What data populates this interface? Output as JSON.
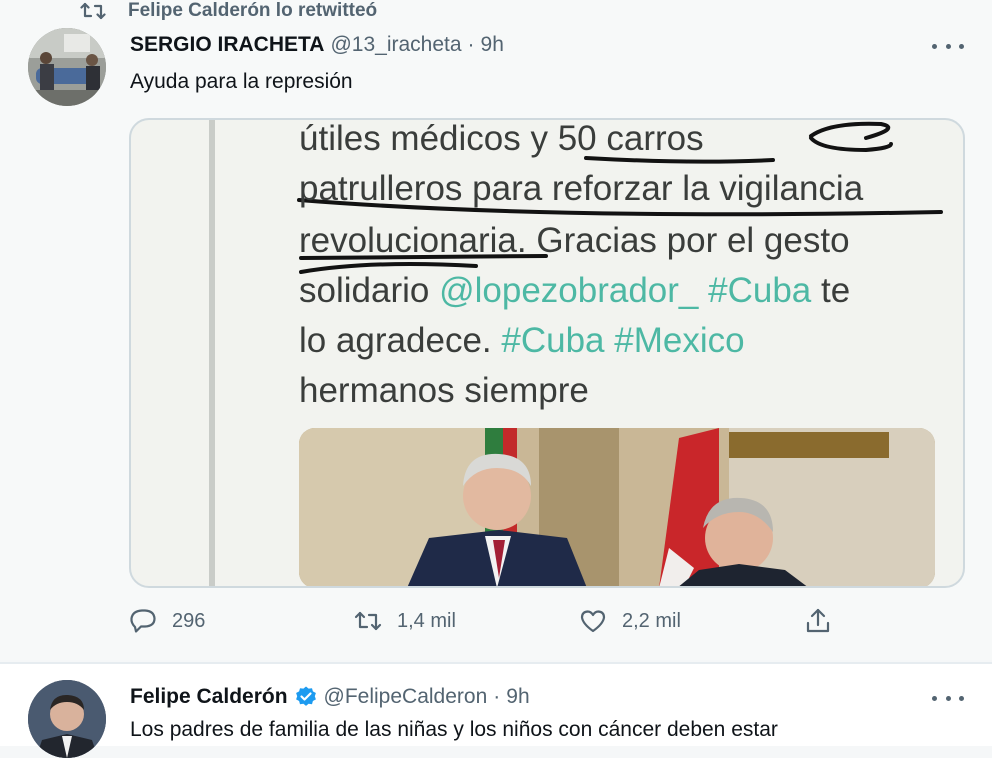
{
  "retweet_banner": {
    "text": "Felipe Calderón lo retwitteó",
    "icon": "retweet-icon"
  },
  "tweet1": {
    "display_name": "SERGIO IRACHETA",
    "handle": "@13_iracheta",
    "separator": "·",
    "time": "9h",
    "text": "Ayuda para la represión",
    "media": {
      "line1": {
        "a": "útiles médicos y ",
        "b": "50 carros"
      },
      "line2": "patrulleros para reforzar la vigilancia",
      "line3": "revolucionaria. Gracias por el gesto",
      "line4": {
        "a": "solidario ",
        "b": "@lopezobrador_ #Cuba",
        "c": " te"
      },
      "line5": {
        "a": "lo agradece. ",
        "b": "#Cuba #Mexico"
      },
      "line6": "hermanos siempre"
    },
    "actions": {
      "reply_count": "296",
      "retweet_count": "1,4 mil",
      "like_count": "2,2 mil"
    }
  },
  "tweet2": {
    "display_name": "Felipe Calderón",
    "handle": "@FelipeCalderon",
    "separator": "·",
    "time": "9h",
    "verified": true,
    "text": "Los padres de familia de las niñas y los niños con cáncer deben estar"
  },
  "colors": {
    "accent": "#1d9bf0",
    "secondary_text": "#536471",
    "hashtag_in_image": "#4db8a4"
  }
}
